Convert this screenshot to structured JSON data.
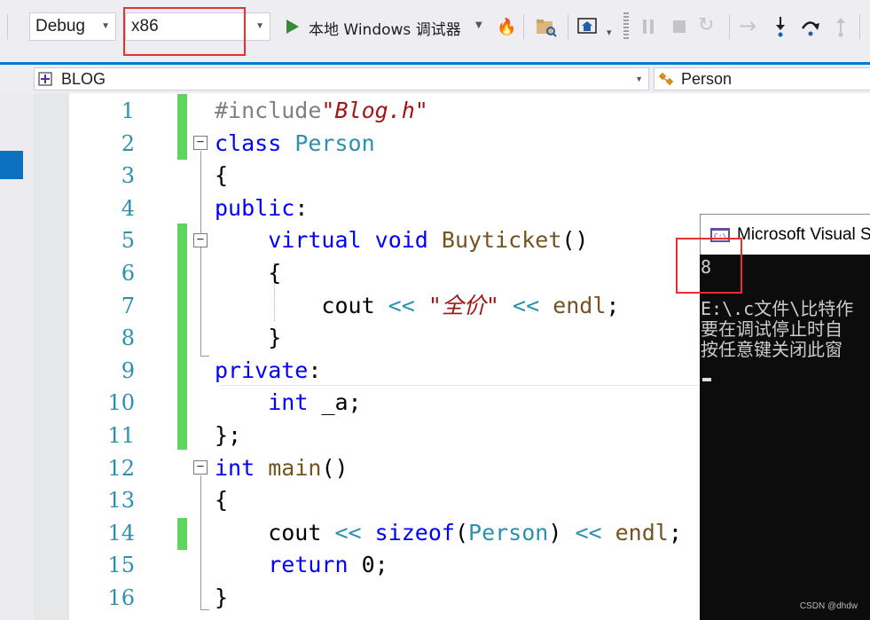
{
  "toolbar": {
    "config_value": "Debug",
    "platform_value": "x86",
    "run_label": "本地 Windows 调试器"
  },
  "navbar": {
    "project": "BLOG",
    "scope": "Person"
  },
  "editor": {
    "line_numbers": [
      "1",
      "2",
      "3",
      "4",
      "5",
      "6",
      "7",
      "8",
      "9",
      "10",
      "11",
      "12",
      "13",
      "14",
      "15",
      "16"
    ],
    "lines": [
      [
        {
          "t": "#include",
          "c": "pp"
        },
        {
          "t": "\"Blog.h\"",
          "c": "st"
        }
      ],
      [
        {
          "t": "class ",
          "c": "kw"
        },
        {
          "t": "Person",
          "c": "ty"
        }
      ],
      [
        {
          "t": "{",
          "c": ""
        }
      ],
      [
        {
          "t": "public",
          "c": "kw"
        },
        {
          "t": ":",
          "c": ""
        }
      ],
      [
        {
          "t": "    ",
          "c": ""
        },
        {
          "t": "virtual ",
          "c": "kw"
        },
        {
          "t": "void ",
          "c": "kw"
        },
        {
          "t": "Buyticket",
          "c": "fn"
        },
        {
          "t": "()",
          "c": ""
        }
      ],
      [
        {
          "t": "    {",
          "c": ""
        }
      ],
      [
        {
          "t": "        cout ",
          "c": ""
        },
        {
          "t": "<<",
          "c": "ty"
        },
        {
          "t": " ",
          "c": ""
        },
        {
          "t": "\"全价\"",
          "c": "st"
        },
        {
          "t": " ",
          "c": ""
        },
        {
          "t": "<<",
          "c": "ty"
        },
        {
          "t": " ",
          "c": ""
        },
        {
          "t": "endl",
          "c": "fn"
        },
        {
          "t": ";",
          "c": ""
        }
      ],
      [
        {
          "t": "    }",
          "c": ""
        }
      ],
      [
        {
          "t": "private",
          "c": "kw"
        },
        {
          "t": ":",
          "c": ""
        }
      ],
      [
        {
          "t": "    ",
          "c": ""
        },
        {
          "t": "int ",
          "c": "kw"
        },
        {
          "t": "_a;",
          "c": ""
        }
      ],
      [
        {
          "t": "};",
          "c": ""
        }
      ],
      [
        {
          "t": "int ",
          "c": "kw"
        },
        {
          "t": "main",
          "c": "fn"
        },
        {
          "t": "()",
          "c": ""
        }
      ],
      [
        {
          "t": "{",
          "c": ""
        }
      ],
      [
        {
          "t": "    cout ",
          "c": ""
        },
        {
          "t": "<<",
          "c": "ty"
        },
        {
          "t": " ",
          "c": ""
        },
        {
          "t": "sizeof",
          "c": "kw"
        },
        {
          "t": "(",
          "c": ""
        },
        {
          "t": "Person",
          "c": "ty"
        },
        {
          "t": ") ",
          "c": ""
        },
        {
          "t": "<<",
          "c": "ty"
        },
        {
          "t": " ",
          "c": ""
        },
        {
          "t": "endl",
          "c": "fn"
        },
        {
          "t": ";",
          "c": ""
        }
      ],
      [
        {
          "t": "    ",
          "c": ""
        },
        {
          "t": "return ",
          "c": "kw"
        },
        {
          "t": "0;",
          "c": ""
        }
      ],
      [
        {
          "t": "}",
          "c": ""
        }
      ]
    ]
  },
  "console": {
    "title": "Microsoft Visual S",
    "output": "8",
    "line1": "E:\\.c文件\\比特作",
    "line2": "要在调试停止时自",
    "line3": "按任意键关闭此窗"
  },
  "watermark": "CSDN @dhdw"
}
